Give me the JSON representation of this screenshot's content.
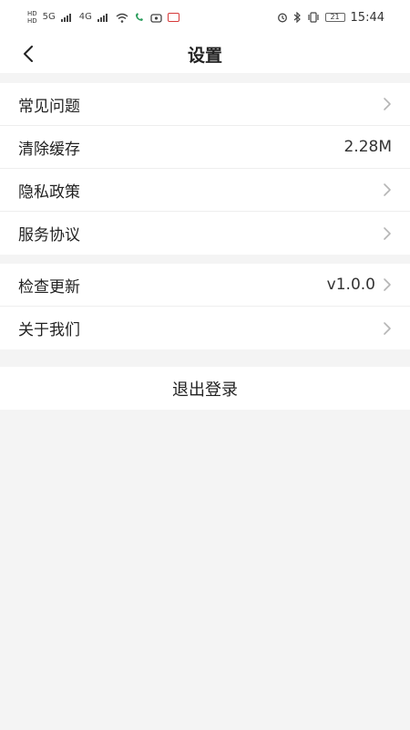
{
  "status_bar": {
    "hd_top": "HD",
    "hd_bottom": "HD",
    "net_5g": "5G",
    "net_4g": "4G",
    "time": "15:44",
    "battery": "21"
  },
  "nav": {
    "title": "设置"
  },
  "group1": {
    "items": [
      {
        "label": "常见问题",
        "value": ""
      },
      {
        "label": "清除缓存",
        "value": "2.28M"
      },
      {
        "label": "隐私政策",
        "value": ""
      },
      {
        "label": "服务协议",
        "value": ""
      }
    ]
  },
  "group2": {
    "items": [
      {
        "label": "检查更新",
        "value": "v1.0.0"
      },
      {
        "label": "关于我们",
        "value": ""
      }
    ]
  },
  "logout": {
    "label": "退出登录"
  }
}
